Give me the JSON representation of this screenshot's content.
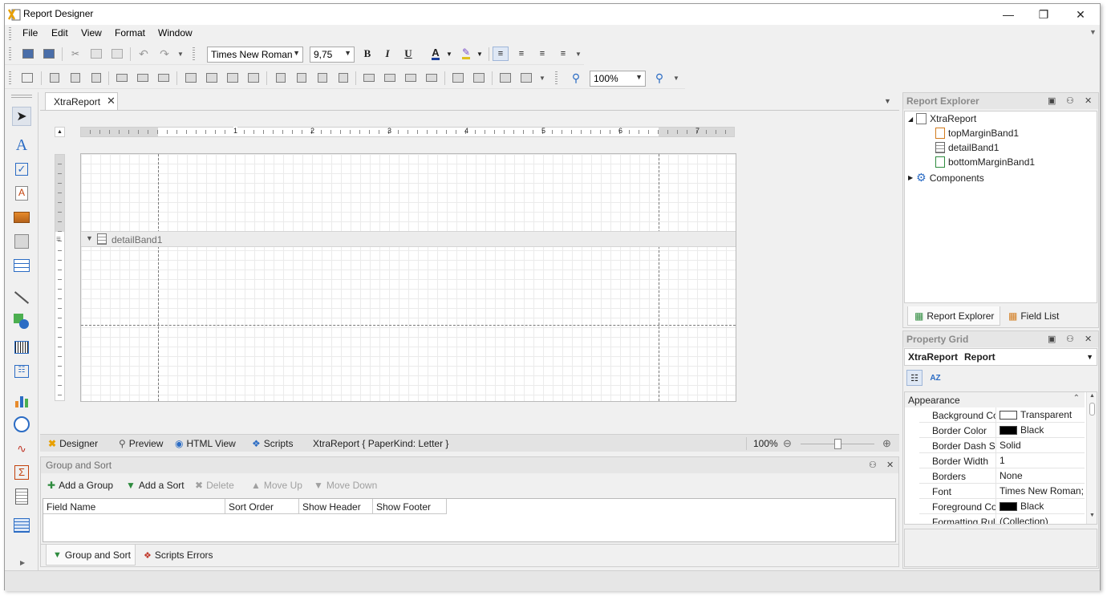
{
  "window": {
    "title": "Report Designer"
  },
  "menu": [
    "File",
    "Edit",
    "View",
    "Format",
    "Window"
  ],
  "format_toolbar": {
    "font": "Times New Roman",
    "size": "9,75",
    "bold": "B",
    "italic": "I",
    "underline": "U",
    "font_color": "A"
  },
  "layout_toolbar": {
    "zoom": "100%"
  },
  "document_tab": {
    "label": "XtraReport"
  },
  "band": {
    "label": "detailBand1"
  },
  "ruler_numbers": [
    "1",
    "2",
    "3",
    "4",
    "5",
    "6",
    "7"
  ],
  "viewbar": {
    "designer": "Designer",
    "preview": "Preview",
    "html_view": "HTML View",
    "scripts": "Scripts",
    "status": "XtraReport { PaperKind: Letter }",
    "zoom": "100%"
  },
  "group_sort": {
    "title": "Group and Sort",
    "add_group": "Add a Group",
    "add_sort": "Add a Sort",
    "delete": "Delete",
    "move_up": "Move Up",
    "move_down": "Move Down",
    "columns": [
      "Field Name",
      "Sort Order",
      "Show Header",
      "Show Footer"
    ],
    "tabs": [
      "Group and Sort",
      "Scripts Errors"
    ]
  },
  "report_explorer": {
    "title": "Report Explorer",
    "root": "XtraReport",
    "children": [
      "topMarginBand1",
      "detailBand1",
      "bottomMarginBand1"
    ],
    "components": "Components",
    "tabs": [
      "Report Explorer",
      "Field List"
    ]
  },
  "property_grid": {
    "title": "Property Grid",
    "selector_name": "XtraReport",
    "selector_type": "Report",
    "category": "Appearance",
    "rows": [
      {
        "name": "Background Colo",
        "value": "Transparent",
        "swatch": "#ffffff"
      },
      {
        "name": "Border Color",
        "value": "Black",
        "swatch": "#000000"
      },
      {
        "name": "Border Dash Sty",
        "value": "Solid"
      },
      {
        "name": "Border Width",
        "value": "1"
      },
      {
        "name": "Borders",
        "value": "None"
      },
      {
        "name": "Font",
        "value": "Times New Roman;...",
        "expandable": true
      },
      {
        "name": "Foreground Colo",
        "value": "Black",
        "swatch": "#000000"
      },
      {
        "name": "Formatting Rule",
        "value": "(Collection)"
      }
    ]
  },
  "colors": {
    "accent": "#2b6cc4",
    "band_header": "#ececec",
    "panel_title": "#8a8a8a"
  }
}
